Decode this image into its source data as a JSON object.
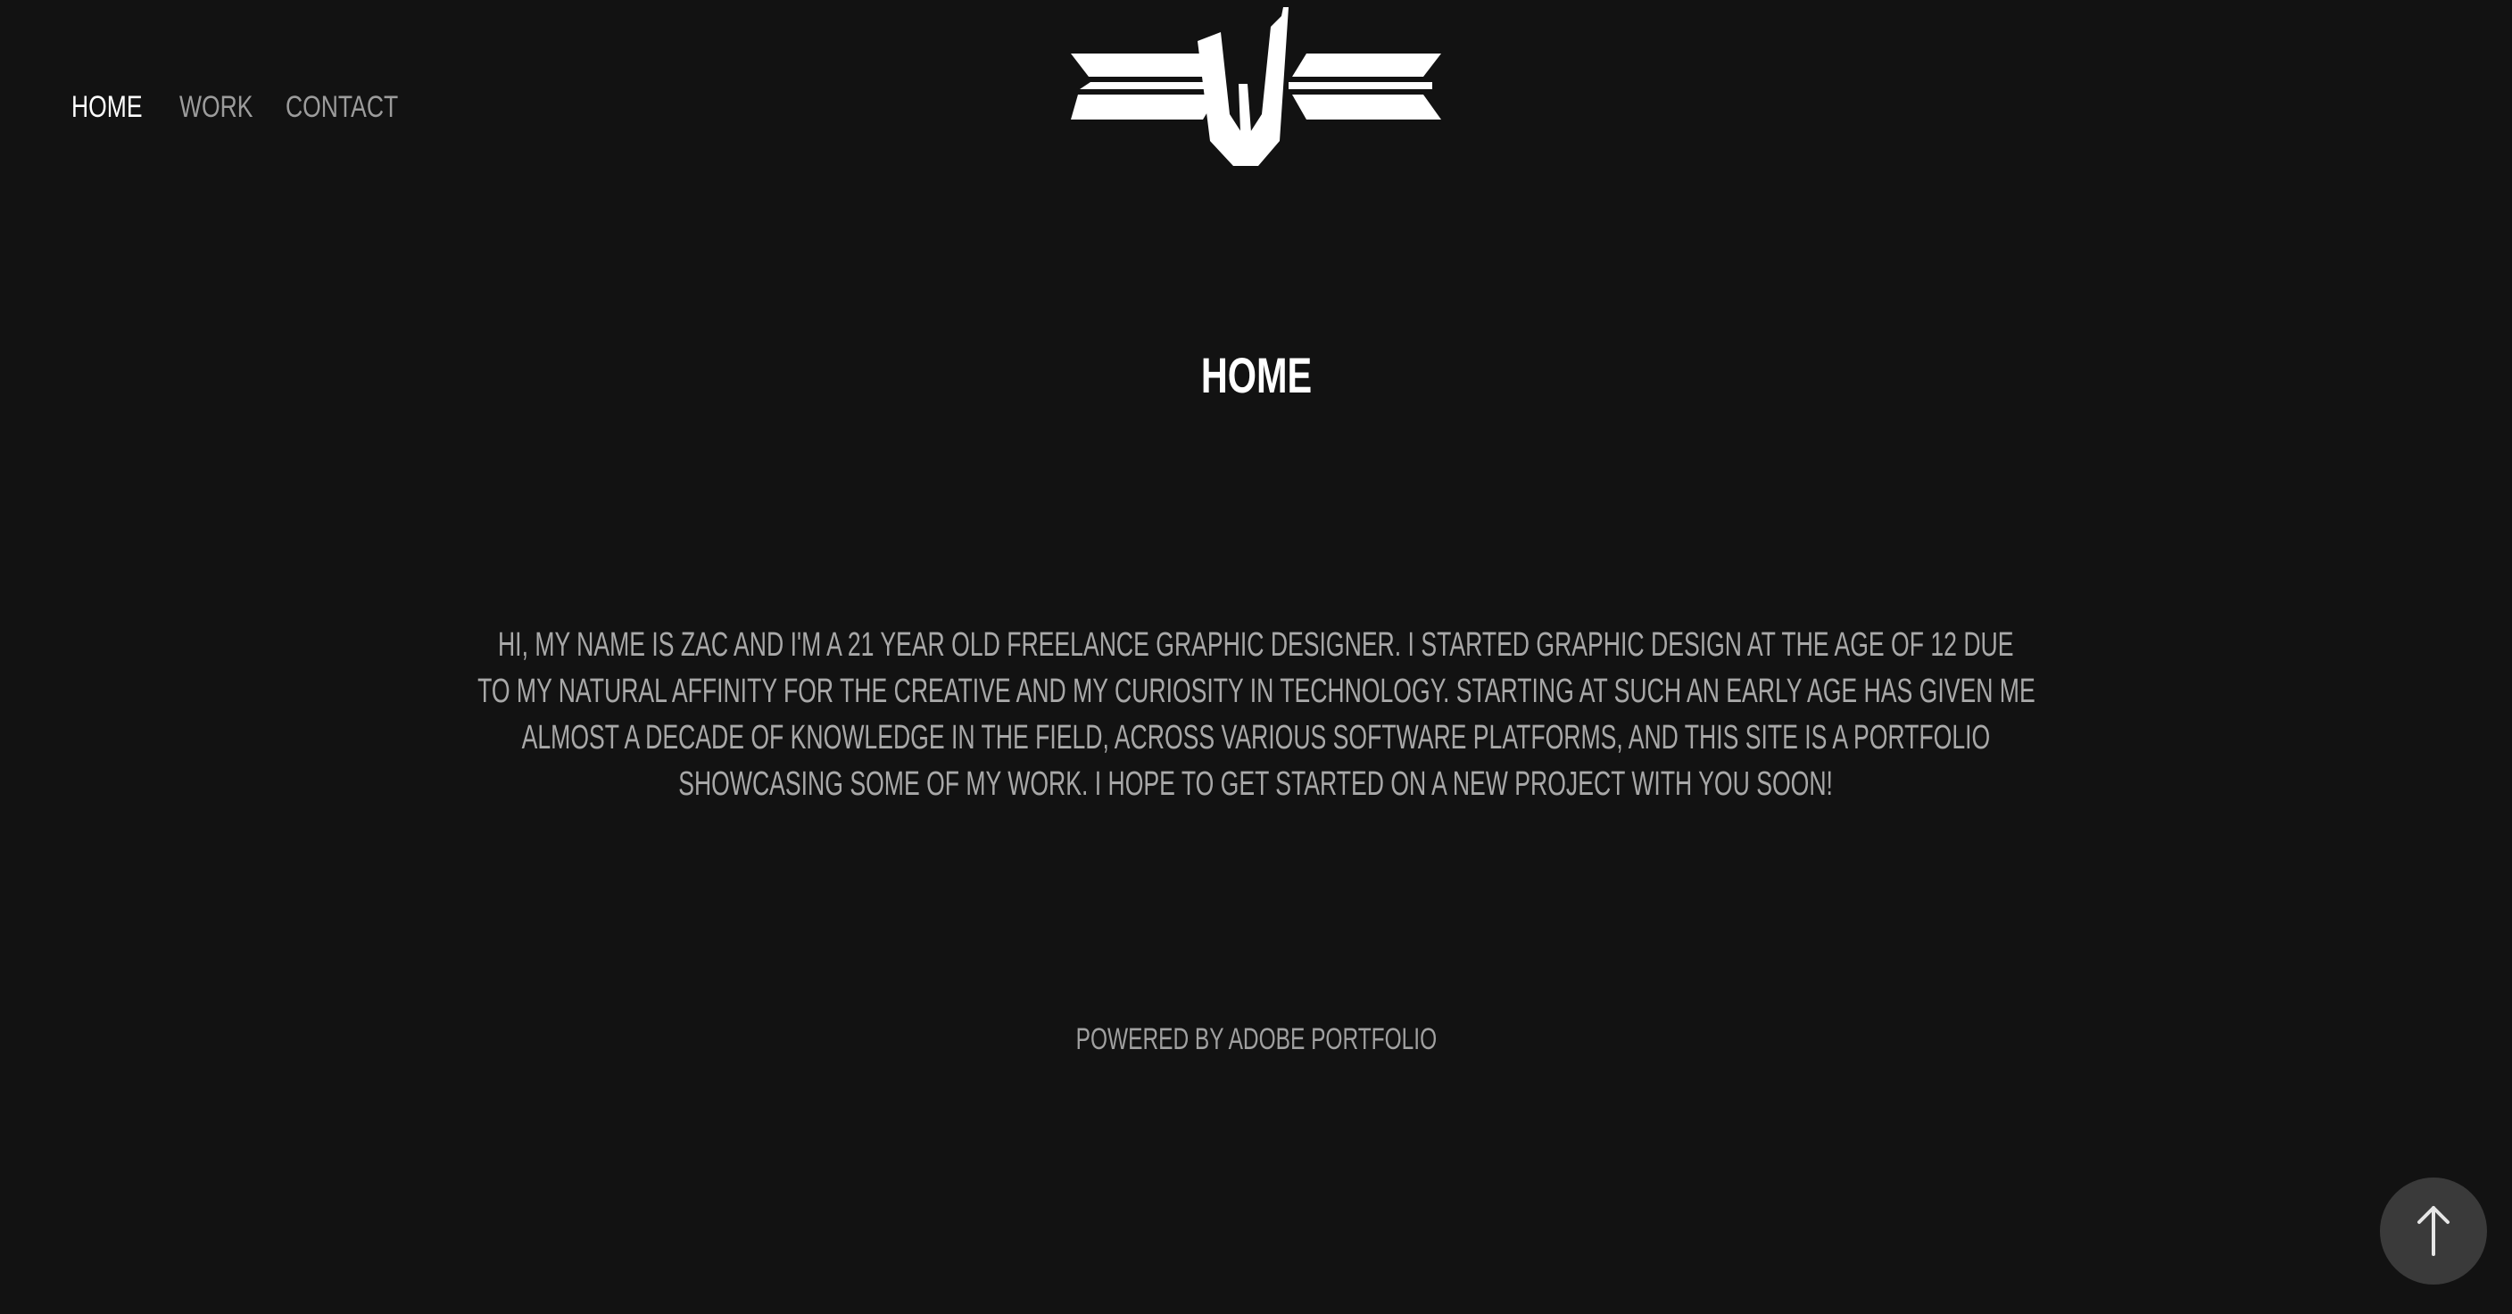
{
  "nav": {
    "items": [
      {
        "label": "HOME",
        "active": true
      },
      {
        "label": "WORK",
        "active": false
      },
      {
        "label": "CONTACT",
        "active": false
      }
    ]
  },
  "logo": {
    "icon": "zv-logo-mark",
    "color": "#ffffff"
  },
  "page": {
    "title": "HOME"
  },
  "intro": {
    "lines": [
      "HI, MY NAME IS ZAC AND I'M A 21  YEAR OLD FREELANCE GRAPHIC DESIGNER. I STARTED GRAPHIC DESIGN AT THE AGE OF 12 DUE",
      "TO MY NATURAL AFFINITY FOR THE CREATIVE AND MY CURIOSITY IN TECHNOLOGY. STARTING AT SUCH AN EARLY AGE HAS GIVEN ME",
      "ALMOST A DECADE OF KNOWLEDGE IN THE FIELD, ACROSS VARIOUS SOFTWARE PLATFORMS, AND THIS SITE IS A PORTFOLIO",
      "SHOWCASING SOME OF MY WORK. I HOPE TO GET STARTED ON A NEW PROJECT WITH YOU SOON!"
    ]
  },
  "footer": {
    "label": "POWERED BY ADOBE PORTFOLIO"
  },
  "back_to_top": {
    "icon": "arrow-up-icon"
  },
  "colors": {
    "background": "#121212",
    "text_active": "#ffffff",
    "text_muted": "#9c9c9c",
    "button_bg": "#3a3a3a"
  }
}
